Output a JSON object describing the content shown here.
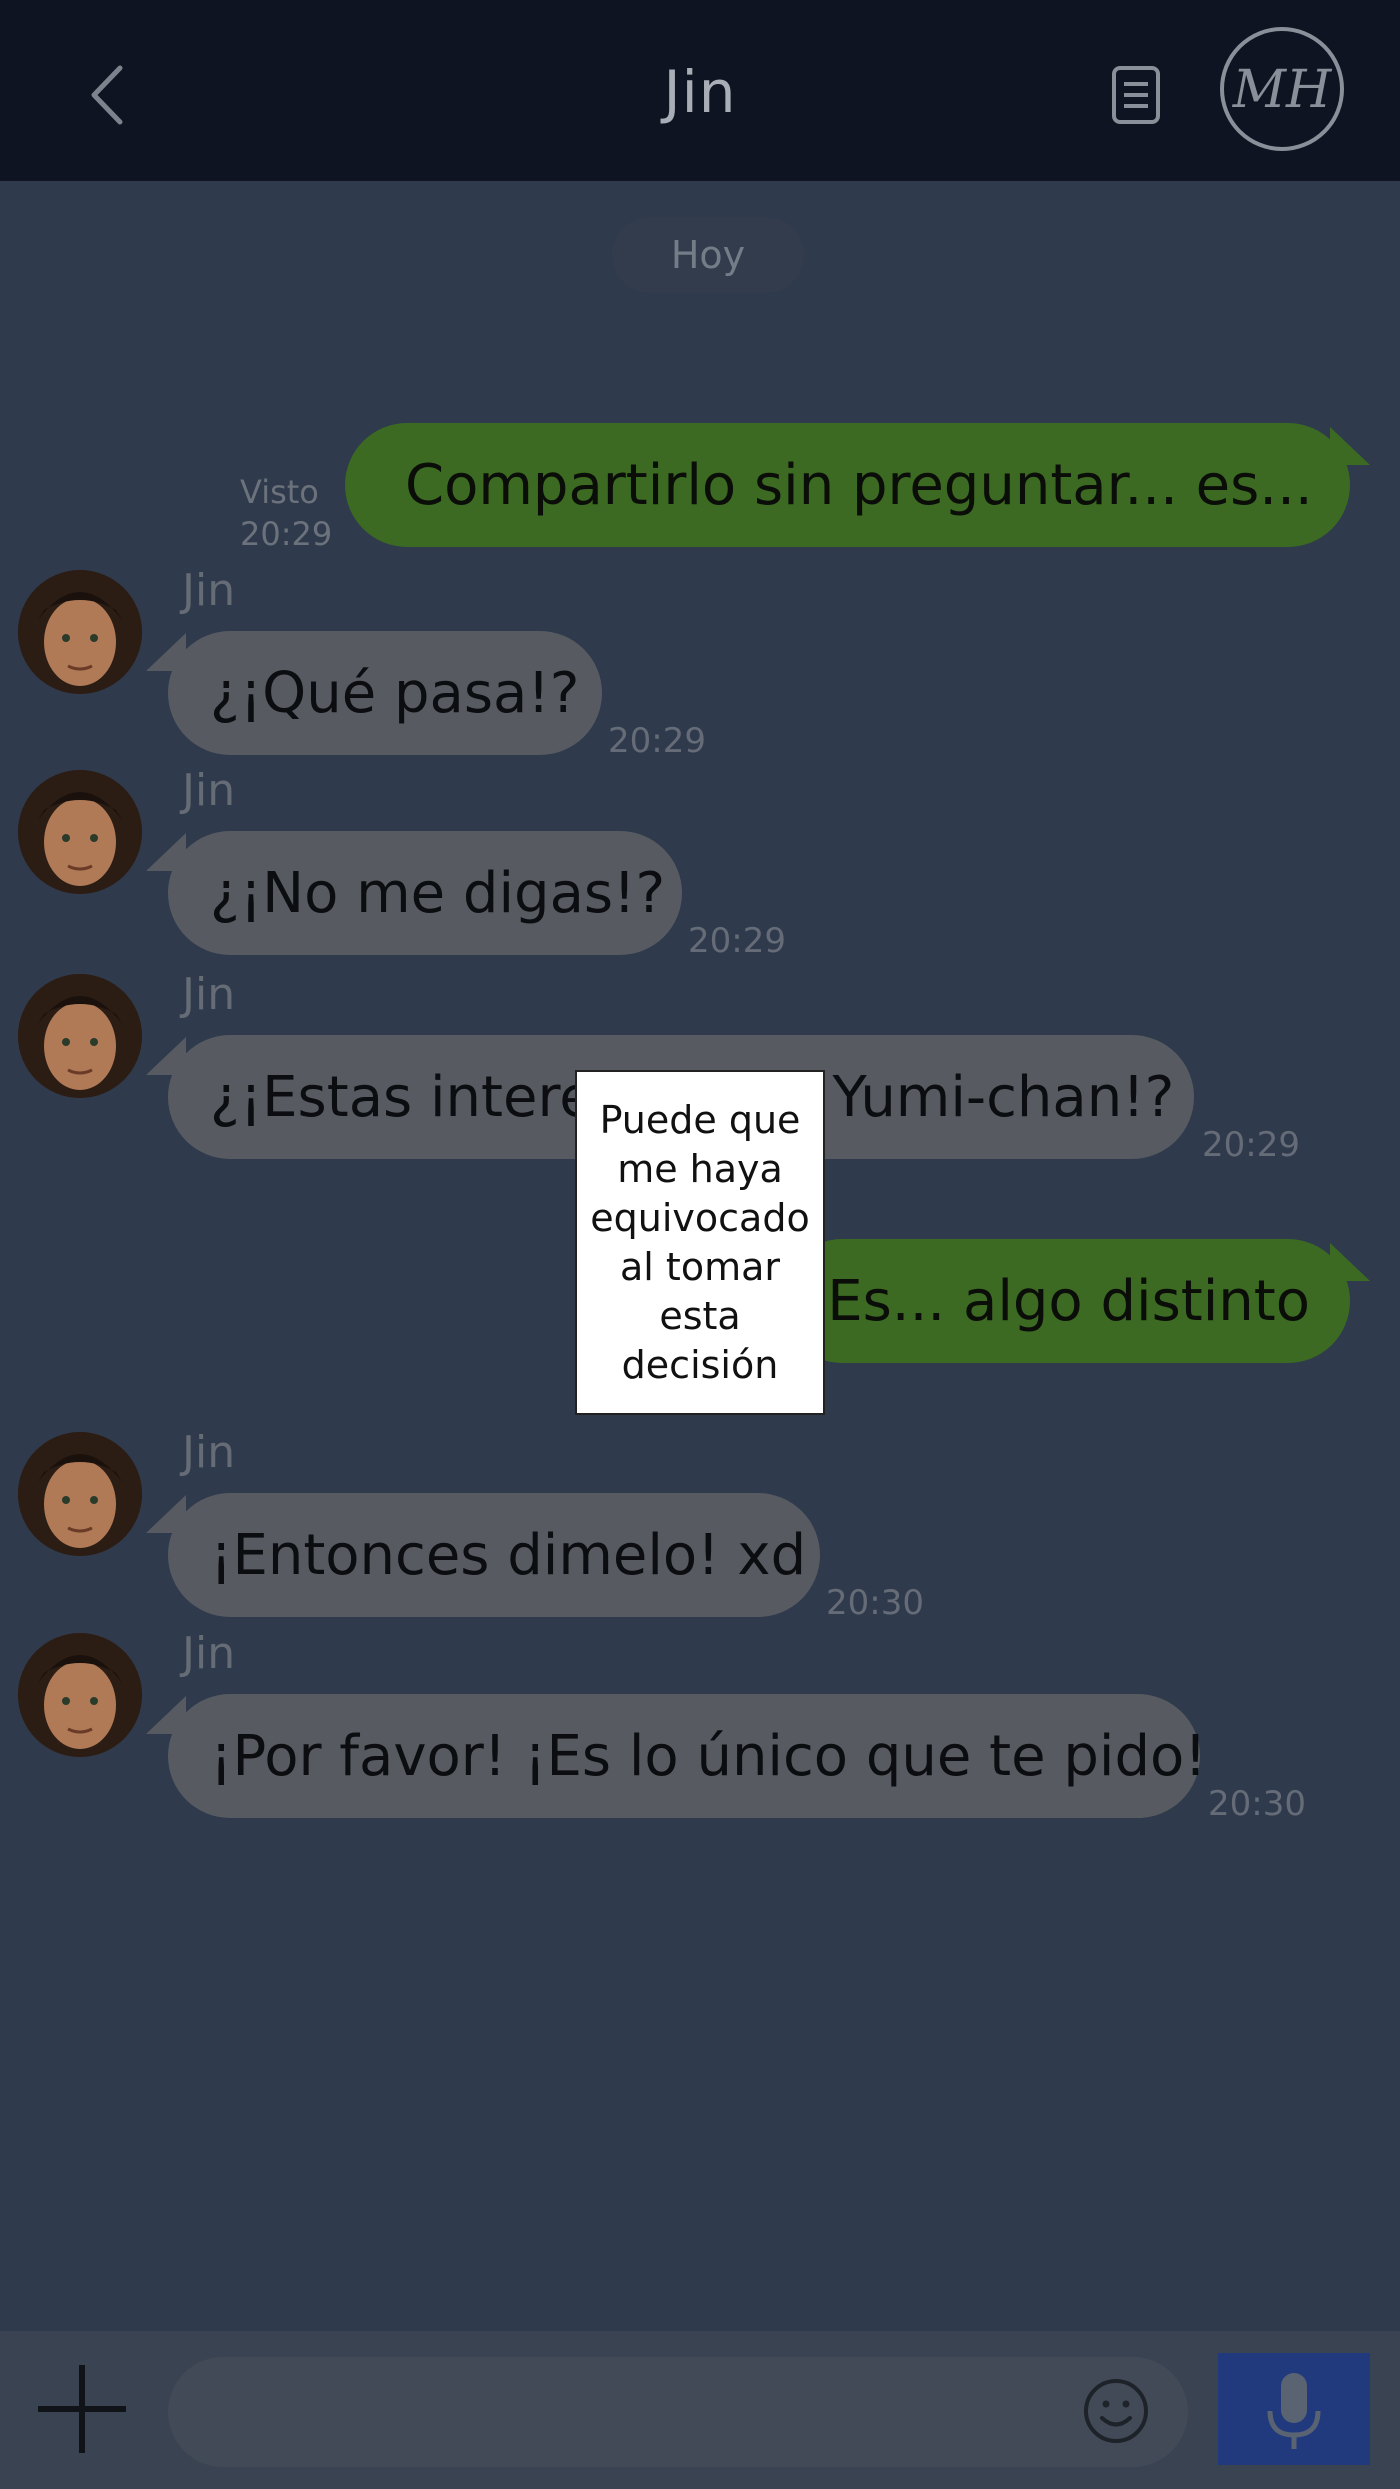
{
  "header": {
    "title": "Jin",
    "back_icon": "chevron-left-icon",
    "menu_icon": "document-icon",
    "logo_text": "MH"
  },
  "chat": {
    "date_label": "Hoy",
    "seen_label": "Visto",
    "messages": [
      {
        "from": "me",
        "text": "Compartirlo sin preguntar... es...",
        "time": "20:29"
      },
      {
        "from": "Jin",
        "text": "¿¡Qué pasa!?",
        "time": "20:29"
      },
      {
        "from": "Jin",
        "text": "¿¡No me digas!?",
        "time": "20:29"
      },
      {
        "from": "Jin",
        "text": "¿¡Estas interesado en Yumi-chan!?",
        "time": "20:29"
      },
      {
        "from": "me",
        "text": "Es... algo distinto"
      },
      {
        "from": "Jin",
        "text": "¡Entonces dimelo! xd",
        "time": "20:30"
      },
      {
        "from": "Jin",
        "text": "¡Por favor! ¡Es lo único que te pido!",
        "time": "20:30"
      }
    ]
  },
  "popup": {
    "text": "Puede que me haya equivocado al tomar esta decisión"
  },
  "footer": {
    "input_placeholder": "",
    "plus_icon": "plus-icon",
    "emoji_icon": "smiley-icon",
    "mic_icon": "microphone-icon"
  },
  "colors": {
    "header_bg": "#0f1422",
    "chat_bg": "#2f3a4c",
    "outgoing_bubble": "#3c6a22",
    "incoming_bubble": "#575b61",
    "mic_button": "#213a7d"
  }
}
